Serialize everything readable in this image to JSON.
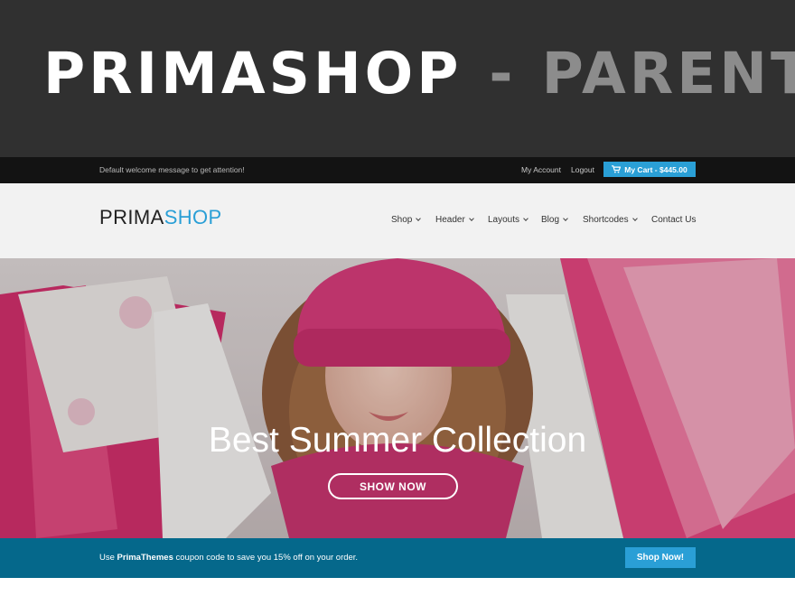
{
  "banner": {
    "title_main": "PRIMASHOP",
    "separator": "-",
    "title_sub": "PARENT"
  },
  "topbar": {
    "welcome": "Default welcome message to get attention!",
    "my_account": "My Account",
    "logout": "Logout",
    "cart_icon": "cart-icon",
    "cart_label": "My Cart - $445.00"
  },
  "header": {
    "logo_a": "PRIMA",
    "logo_b": "SHOP",
    "nav": [
      {
        "label": "Shop",
        "has_dropdown": true
      },
      {
        "label": "Header",
        "has_dropdown": true
      },
      {
        "label": "Layouts",
        "has_dropdown": true
      },
      {
        "label": "Blog",
        "has_dropdown": true
      },
      {
        "label": "Shortcodes",
        "has_dropdown": true
      },
      {
        "label": "Contact Us",
        "has_dropdown": false
      }
    ]
  },
  "hero": {
    "title": "Best Summer Collection",
    "button": "SHOW NOW"
  },
  "promo": {
    "text_pre": "Use ",
    "code": "PrimaThemes",
    "text_post": " coupon code to save you 15% off on your order.",
    "button": "Shop Now!"
  },
  "colors": {
    "accent": "#2a9fd6",
    "promo_bar": "#05688b",
    "banner": "#303030",
    "topbar": "#131313"
  }
}
